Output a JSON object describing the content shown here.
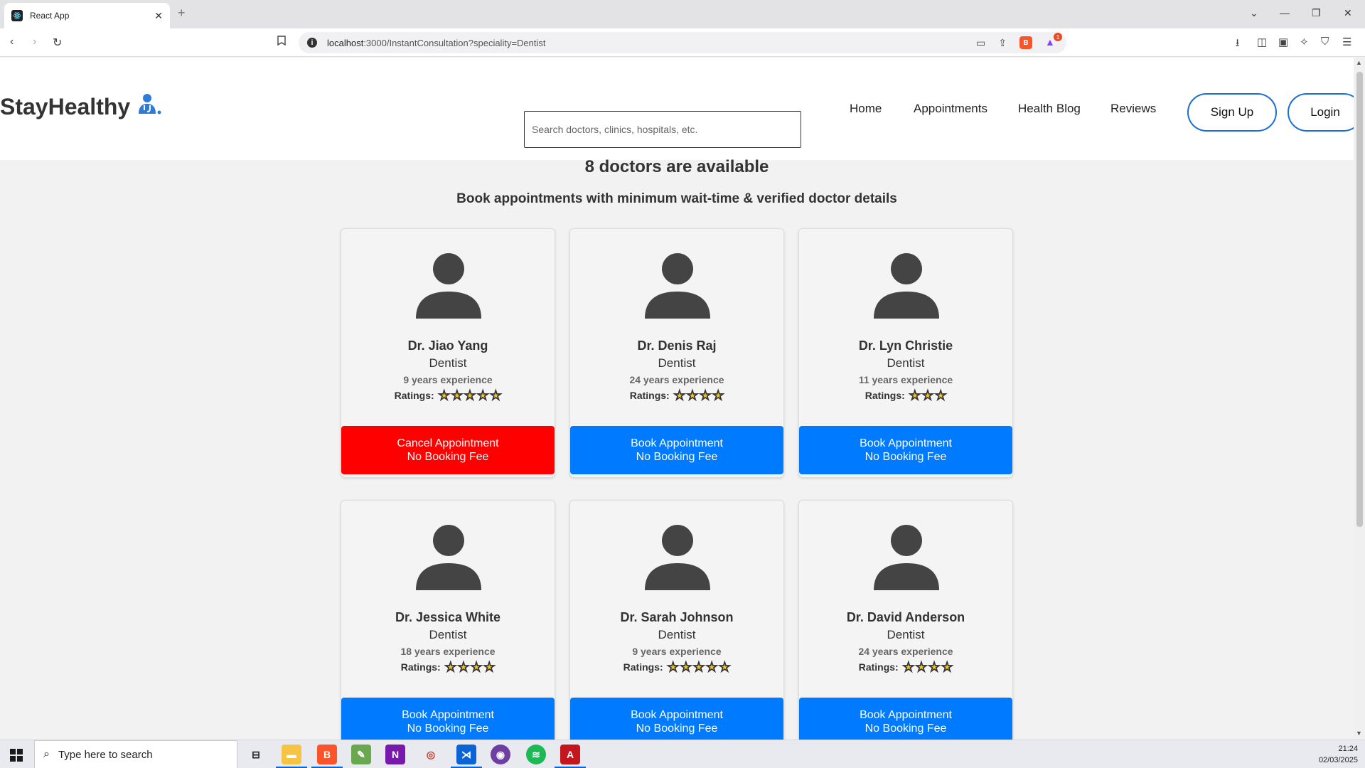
{
  "browser": {
    "tab_title": "React App",
    "url_host": "localhost",
    "url_path": ":3000/InstantConsultation?speciality=Dentist",
    "rewards_count": "1"
  },
  "site": {
    "logo": "StayHealthy",
    "search_placeholder": "Search doctors, clinics, hospitals, etc.",
    "nav": {
      "home": "Home",
      "appointments": "Appointments",
      "health_blog": "Health Blog",
      "reviews": "Reviews",
      "sign_up": "Sign Up",
      "login": "Login"
    },
    "heading": "8 doctors are available",
    "subheading": "Book appointments with minimum wait-time & verified doctor details"
  },
  "doctors": [
    {
      "name": "Dr. Jiao Yang",
      "speciality": "Dentist",
      "experience": "9 years experience",
      "ratings_label": "Ratings:",
      "stars": 5,
      "button_line1": "Cancel Appointment",
      "button_line2": "No Booking Fee",
      "booked": true
    },
    {
      "name": "Dr. Denis Raj",
      "speciality": "Dentist",
      "experience": "24 years experience",
      "ratings_label": "Ratings:",
      "stars": 4,
      "button_line1": "Book Appointment",
      "button_line2": "No Booking Fee",
      "booked": false
    },
    {
      "name": "Dr. Lyn Christie",
      "speciality": "Dentist",
      "experience": "11 years experience",
      "ratings_label": "Ratings:",
      "stars": 3,
      "button_line1": "Book Appointment",
      "button_line2": "No Booking Fee",
      "booked": false
    },
    {
      "name": "Dr. Jessica White",
      "speciality": "Dentist",
      "experience": "18 years experience",
      "ratings_label": "Ratings:",
      "stars": 4,
      "button_line1": "Book Appointment",
      "button_line2": "No Booking Fee",
      "booked": false
    },
    {
      "name": "Dr. Sarah Johnson",
      "speciality": "Dentist",
      "experience": "9 years experience",
      "ratings_label": "Ratings:",
      "stars": 5,
      "button_line1": "Book Appointment",
      "button_line2": "No Booking Fee",
      "booked": false
    },
    {
      "name": "Dr. David Anderson",
      "speciality": "Dentist",
      "experience": "24 years experience",
      "ratings_label": "Ratings:",
      "stars": 4,
      "button_line1": "Book Appointment",
      "button_line2": "No Booking Fee",
      "booked": false
    }
  ],
  "taskbar": {
    "search_placeholder": "Type here to search",
    "time": "21:24",
    "date": "02/03/2025"
  },
  "colors": {
    "book_button": "#007bff",
    "cancel_button": "#ff0000",
    "star": "#f5c518",
    "pill_border": "#1a6fd6"
  }
}
